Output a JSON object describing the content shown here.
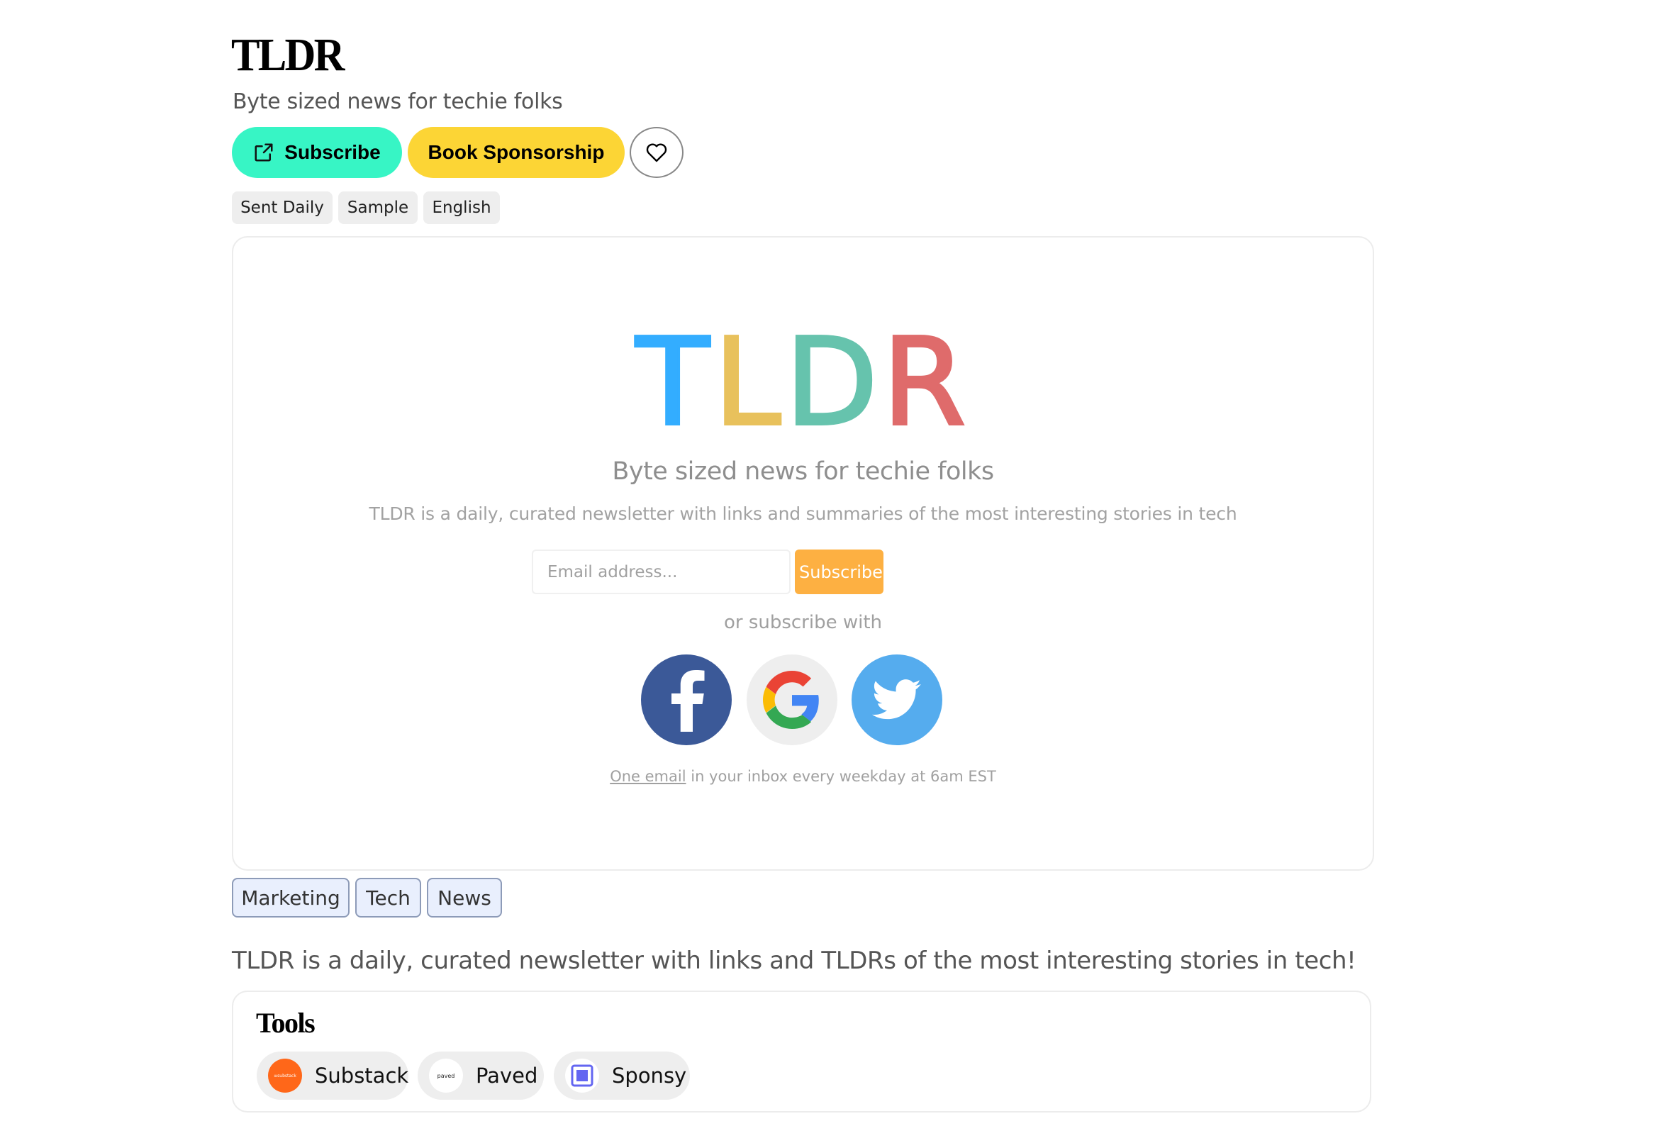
{
  "header": {
    "title": "TLDR",
    "subtitle": "Byte sized news for techie folks",
    "subscribe_label": "Subscribe",
    "sponsorship_label": "Book Sponsorship",
    "favorite_icon": "heart-icon",
    "subscribe_icon": "external-link-icon"
  },
  "meta_tags": [
    "Sent Daily",
    "Sample",
    "English"
  ],
  "preview": {
    "logo_letters": [
      {
        "char": "T",
        "color": "#33adff"
      },
      {
        "char": "L",
        "color": "#e8c15c"
      },
      {
        "char": "D",
        "color": "#66c3ad"
      },
      {
        "char": "R",
        "color": "#df6b6b"
      }
    ],
    "tagline": "Byte sized news for techie folks",
    "description": "TLDR is a daily, curated newsletter with links and summaries of the most interesting stories in tech",
    "email_placeholder": "Email address...",
    "email_value": "",
    "subscribe_label": "Subscribe",
    "or_text": "or subscribe with",
    "social": [
      {
        "name": "facebook-icon",
        "color": "#3b5998"
      },
      {
        "name": "google-icon",
        "color": "#eeeeee"
      },
      {
        "name": "twitter-icon",
        "color": "#55acee"
      }
    ],
    "footer_link": "One email",
    "footer_text": " in your inbox every weekday at 6am EST"
  },
  "categories": [
    "Marketing",
    "Tech",
    "News"
  ],
  "about": "TLDR is a daily, curated newsletter with links and TLDRs of the most interesting stories in tech!",
  "tools": {
    "title": "Tools",
    "items": [
      {
        "label": "Substack",
        "icon_text": "≡substack",
        "icon_color": "#ff6719"
      },
      {
        "label": "Paved",
        "icon_text": "paved",
        "icon_color": "#ffffff"
      },
      {
        "label": "Sponsy",
        "icon_text": "",
        "icon_color": "#6366f1"
      }
    ]
  },
  "colors": {
    "subscribe_button": "#37f5c5",
    "sponsorship_button": "#fcd535",
    "preview_subscribe": "#fdb042"
  }
}
